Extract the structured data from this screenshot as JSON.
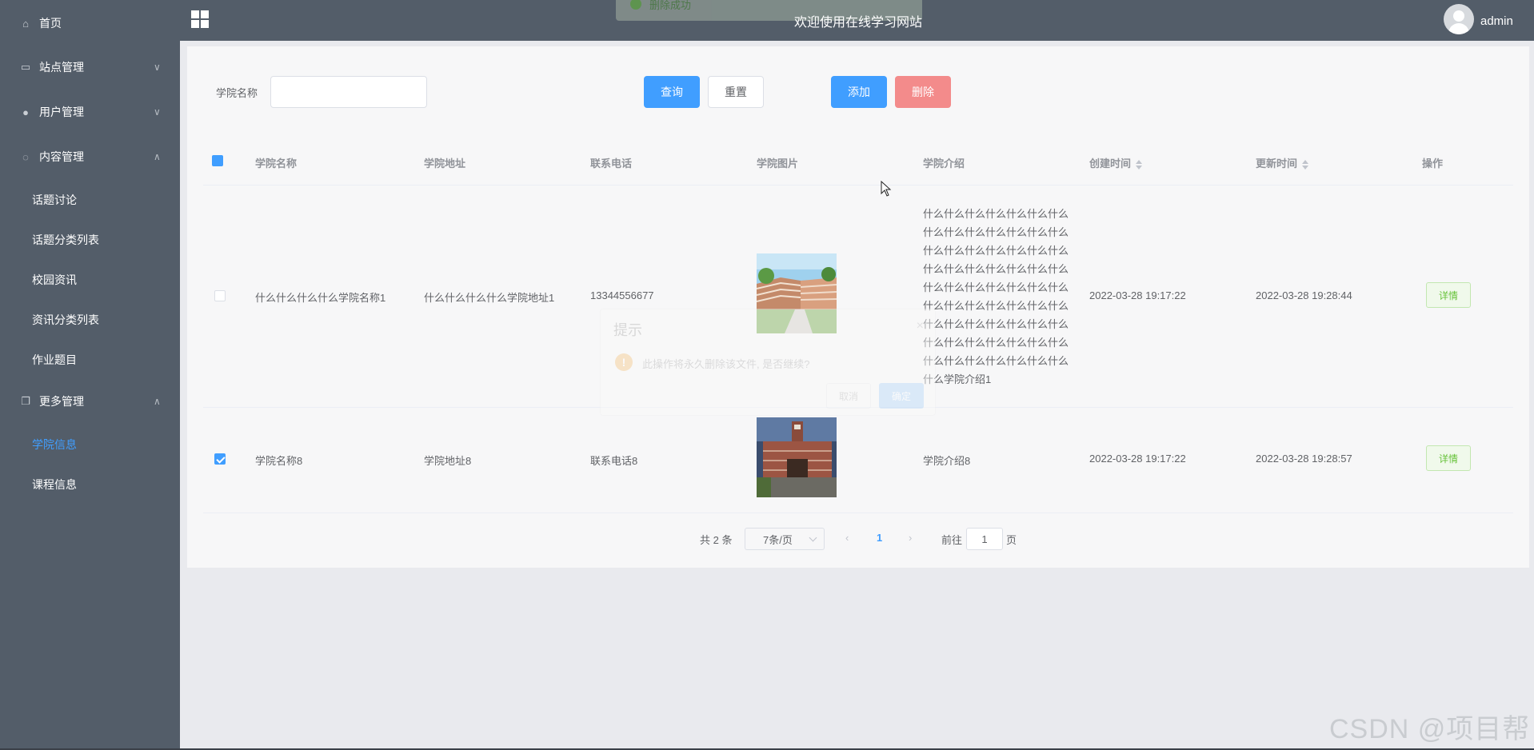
{
  "sidebar": {
    "items": [
      {
        "label": "首页",
        "icon": "home-icon",
        "glyph": "⌂"
      },
      {
        "label": "站点管理",
        "icon": "monitor-icon",
        "glyph": "▭",
        "arrow": "∨"
      },
      {
        "label": "用户管理",
        "icon": "user-icon",
        "glyph": "●",
        "arrow": "∨"
      },
      {
        "label": "内容管理",
        "icon": "chat-icon",
        "glyph": "◌",
        "arrow": "∧"
      },
      {
        "label": "更多管理",
        "icon": "copy-icon",
        "glyph": "❐",
        "arrow": "∧"
      }
    ],
    "content_sub": [
      "话题讨论",
      "话题分类列表",
      "校园资讯",
      "资讯分类列表",
      "作业题目"
    ],
    "more_sub": [
      "学院信息",
      "课程信息"
    ],
    "active_sub": "学院信息"
  },
  "header": {
    "title": "欢迎使用在线学习网站",
    "username": "admin",
    "toast": "删除成功"
  },
  "search": {
    "label": "学院名称",
    "value": ""
  },
  "toolbar": {
    "query": "查询",
    "reset": "重置",
    "add": "添加",
    "delete": "删除"
  },
  "table": {
    "headers": [
      "学院名称",
      "学院地址",
      "联系电话",
      "学院图片",
      "学院介绍",
      "创建时间",
      "更新时间",
      "操作"
    ],
    "rows": [
      {
        "checked": false,
        "name": "什么什么什么什么学院名称1",
        "address": "什么什么什么什么学院地址1",
        "phone": "13344556677",
        "intro": "什么什么什么什么什么什么什么什么什么什么什么什么什么什么什么什么什么什么什么什么什么什么什么什么什么什么什么什么什么什么什么什么什么什么什么什么什么什么什么什么什么什么什么什么什么什么什么什么什么什么什么什么什么什么什么什么什么什么什么什么什么什么什么什么学院介绍1",
        "created": "2022-03-28 19:17:22",
        "updated": "2022-03-28 19:28:44",
        "action": "详情"
      },
      {
        "checked": true,
        "name": "学院名称8",
        "address": "学院地址8",
        "phone": "联系电话8",
        "intro": "学院介绍8",
        "created": "2022-03-28 19:17:22",
        "updated": "2022-03-28 19:28:57",
        "action": "详情"
      }
    ]
  },
  "pagination": {
    "total": "共 2 条",
    "page_size": "7条/页",
    "prev": "‹",
    "current": "1",
    "next": "›",
    "goto_label": "前往",
    "goto_value": "1",
    "page_suffix": "页"
  },
  "dialog": {
    "title": "提示",
    "close": "×",
    "message": "此操作将永久删除该文件, 是否继续?",
    "cancel": "取消",
    "confirm": "确定"
  },
  "watermark": "CSDN @项目帮",
  "colors": {
    "sidebar_bg": "#535d69",
    "primary": "#409eff",
    "danger_light": "#f38b8b",
    "success": "#67c23a"
  }
}
